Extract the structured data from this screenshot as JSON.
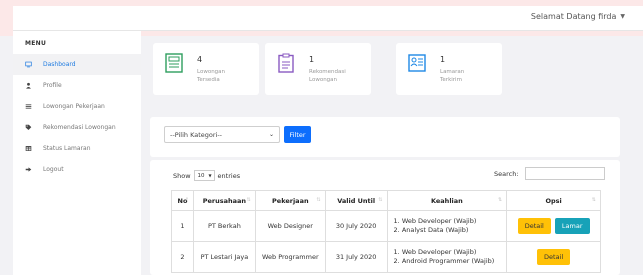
{
  "header": {
    "greeting": "Selamat Datang firda"
  },
  "sidebar": {
    "title": "MENU",
    "items": [
      {
        "label": "Dashboard",
        "icon": "monitor-icon"
      },
      {
        "label": "Profile",
        "icon": "user-icon"
      },
      {
        "label": "Lowongan Pekerjaan",
        "icon": "list-icon"
      },
      {
        "label": "Rekomendasi Lowongan",
        "icon": "tag-icon"
      },
      {
        "label": "Status Lamaran",
        "icon": "table-icon"
      },
      {
        "label": "Logout",
        "icon": "logout-icon"
      }
    ]
  },
  "cards": [
    {
      "count": "4",
      "label_line1": "Lowongan",
      "label_line2": "Tersedia",
      "icon": "newspaper-icon",
      "color": "#2e9e5e"
    },
    {
      "count": "1",
      "label_line1": "Rekomendasi",
      "label_line2": "Lowongan",
      "icon": "clipboard-icon",
      "color": "#8a5ac2"
    },
    {
      "count": "1",
      "label_line1": "Lamaran",
      "label_line2": "Terkirim",
      "icon": "resume-icon",
      "color": "#1e88e5"
    }
  ],
  "filter": {
    "select_value": "--Pilih Kategori--",
    "button_label": "Filter"
  },
  "table": {
    "show_label": "Show",
    "entries_value": "10",
    "entries_label": "entries",
    "search_label": "Search:",
    "columns": [
      "No",
      "Perusahaan",
      "Pekerjaan",
      "Valid Until",
      "Keahlian",
      "Opsi"
    ],
    "rows": [
      {
        "no": "1",
        "perusahaan": "PT Berkah",
        "pekerjaan": "Web Designer",
        "valid_until": "30 July 2020",
        "keahlian_1": "1. Web Developer (Wajib)",
        "keahlian_2": "2. Analyst Data (Wajib)",
        "detail_label": "Detail",
        "lamar_label": "Lamar"
      },
      {
        "no": "2",
        "perusahaan": "PT Lestari Jaya",
        "pekerjaan": "Web Programmer",
        "valid_until": "31 July 2020",
        "keahlian_1": "1. Web Developer (Wajib)",
        "keahlian_2": "2. Android Programmer (Wajib)",
        "detail_label": "Detail"
      }
    ]
  },
  "colors": {
    "primary": "#0d6efd",
    "warning": "#ffc107",
    "info": "#17a2b8",
    "active_link": "#1e7be0"
  }
}
